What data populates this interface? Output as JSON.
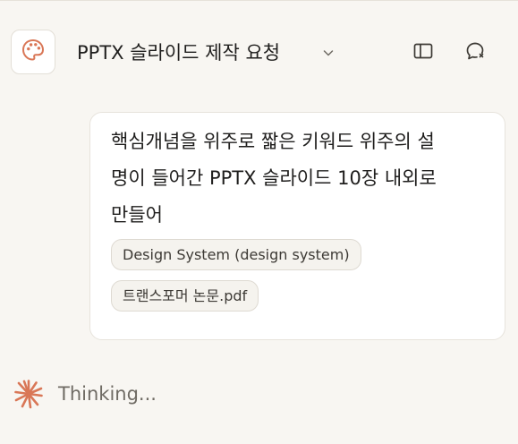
{
  "header": {
    "title": "PPTX 슬라이드 제작 요청",
    "app_icon": "palette-icon",
    "dropdown_icon": "chevron-down-icon",
    "sidebar_icon": "sidebar-toggle-icon",
    "chat_icon": "new-chat-icon"
  },
  "message": {
    "line1": "핵심개념을 위주로 짧은 키워드 위주의 설",
    "line2": "명이 들어간 PPTX 슬라이드 10장 내외로",
    "line3": "만들어",
    "attachments": [
      {
        "label": "Design System (design system)"
      },
      {
        "label": "트랜스포머 논문.pdf"
      }
    ]
  },
  "status": {
    "text": "Thinking...",
    "icon": "spark-icon",
    "accent_color": "#d97757"
  }
}
